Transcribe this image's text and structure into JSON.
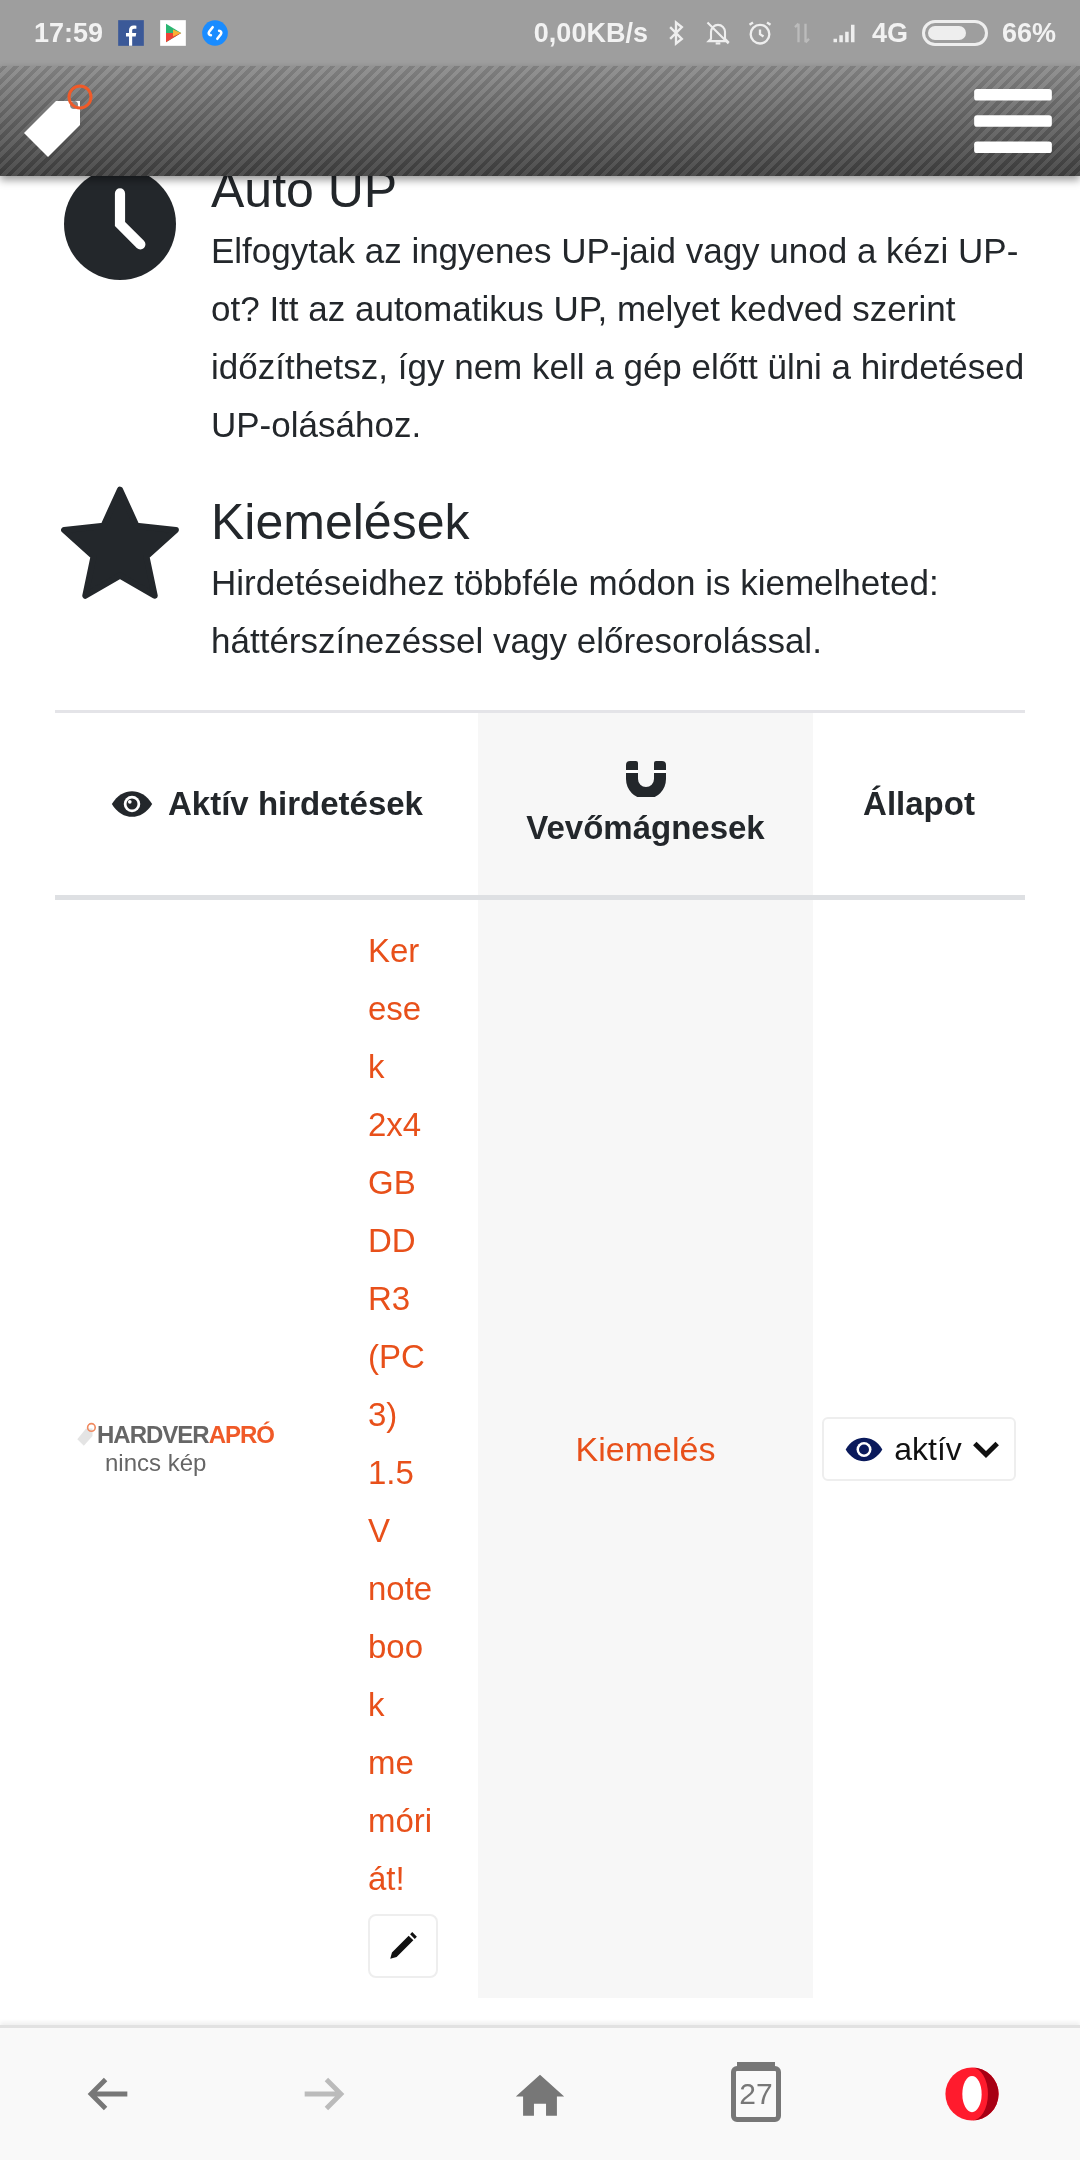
{
  "status_bar": {
    "time": "17:59",
    "speed": "0,00KB/s",
    "network": "4G",
    "battery": "66%"
  },
  "sections": [
    {
      "kind": "clock",
      "title": "Auto UP",
      "text": "Elfogytak az ingyenes UP-jaid vagy unod a kézi UP-ot? Itt az automatikus UP, melyet kedved szerint időzíthetsz, így nem kell a gép előtt ülni a hirdetésed UP-olásához."
    },
    {
      "kind": "star",
      "title": "Kiemelések",
      "text": "Hirdetéseidhez többféle módon is kiemelheted: háttérszínezéssel vagy előresorolással."
    }
  ],
  "table": {
    "columns": [
      {
        "label": "Aktív hirdetések"
      },
      {
        "label": "Vevőmágnesek"
      },
      {
        "label": "Állapot"
      }
    ],
    "rows": [
      {
        "logo_left": "HARDVER",
        "logo_right": "APRÓ",
        "logo_caption": "nincs kép",
        "title": "Keresek 2x4 GB DDR3 (PC3) 1.5V notebook memóriát!",
        "magnet": "Kiemelés",
        "status": "aktív"
      }
    ]
  },
  "bottom_nav": [
    {
      "kind": "back",
      "disabled": false
    },
    {
      "kind": "forward",
      "disabled": true
    },
    {
      "kind": "home"
    },
    {
      "kind": "tabs",
      "label": "27"
    },
    {
      "kind": "opera"
    }
  ]
}
